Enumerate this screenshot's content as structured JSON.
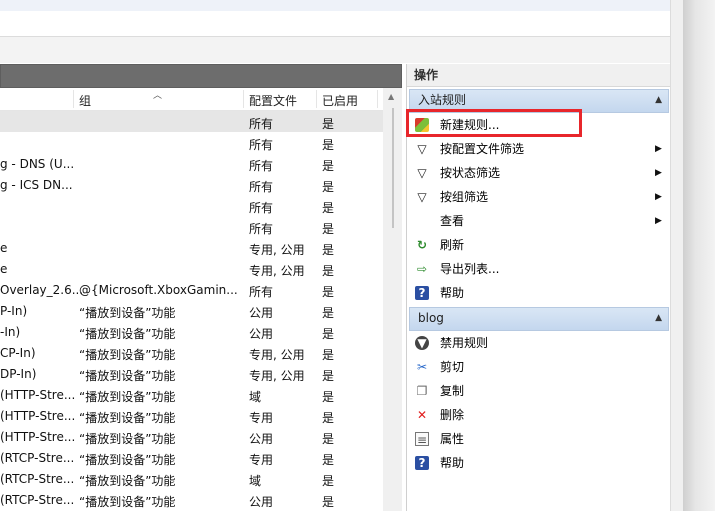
{
  "columns": {
    "group": "组",
    "profile": "配置文件",
    "enabled": "已启用"
  },
  "rows": [
    {
      "name": "",
      "group": "",
      "profile": "所有",
      "enabled": "是"
    },
    {
      "name": "",
      "group": "",
      "profile": "所有",
      "enabled": "是"
    },
    {
      "name": "g - DNS (U...",
      "group": "",
      "profile": "所有",
      "enabled": "是"
    },
    {
      "name": "g - ICS DN...",
      "group": "",
      "profile": "所有",
      "enabled": "是"
    },
    {
      "name": "",
      "group": "",
      "profile": "所有",
      "enabled": "是"
    },
    {
      "name": "",
      "group": "",
      "profile": "所有",
      "enabled": "是"
    },
    {
      "name": "e",
      "group": "",
      "profile": "专用, 公用",
      "enabled": "是"
    },
    {
      "name": "e",
      "group": "",
      "profile": "专用, 公用",
      "enabled": "是"
    },
    {
      "name": "Overlay_2.6...",
      "group": "@{Microsoft.XboxGamin...",
      "profile": "所有",
      "enabled": "是"
    },
    {
      "name": "P-In)",
      "group": "“播放到设备”功能",
      "profile": "公用",
      "enabled": "是"
    },
    {
      "name": "-In)",
      "group": "“播放到设备”功能",
      "profile": "公用",
      "enabled": "是"
    },
    {
      "name": "CP-In)",
      "group": "“播放到设备”功能",
      "profile": "专用, 公用",
      "enabled": "是"
    },
    {
      "name": "DP-In)",
      "group": "“播放到设备”功能",
      "profile": "专用, 公用",
      "enabled": "是"
    },
    {
      "name": "(HTTP-Stre...",
      "group": "“播放到设备”功能",
      "profile": "域",
      "enabled": "是"
    },
    {
      "name": "(HTTP-Stre...",
      "group": "“播放到设备”功能",
      "profile": "专用",
      "enabled": "是"
    },
    {
      "name": "(HTTP-Stre...",
      "group": "“播放到设备”功能",
      "profile": "公用",
      "enabled": "是"
    },
    {
      "name": "(RTCP-Stre...",
      "group": "“播放到设备”功能",
      "profile": "专用",
      "enabled": "是"
    },
    {
      "name": "(RTCP-Stre...",
      "group": "“播放到设备”功能",
      "profile": "域",
      "enabled": "是"
    },
    {
      "name": "(RTCP-Stre...",
      "group": "“播放到设备”功能",
      "profile": "公用",
      "enabled": "是"
    }
  ],
  "actions": {
    "title": "操作",
    "section1": {
      "label": "入站规则",
      "items": [
        {
          "label": "新建规则...",
          "icon": "new-rule-icon"
        },
        {
          "label": "按配置文件筛选",
          "icon": "filter-icon"
        },
        {
          "label": "按状态筛选",
          "icon": "filter-icon"
        },
        {
          "label": "按组筛选",
          "icon": "filter-icon"
        },
        {
          "label": "查看",
          "icon": ""
        },
        {
          "label": "刷新",
          "icon": "refresh-icon"
        },
        {
          "label": "导出列表...",
          "icon": "export-icon"
        },
        {
          "label": "帮助",
          "icon": "help-icon"
        }
      ]
    },
    "section2": {
      "label": "blog",
      "items": [
        {
          "label": "禁用规则",
          "icon": "disable-icon"
        },
        {
          "label": "剪切",
          "icon": "cut-icon"
        },
        {
          "label": "复制",
          "icon": "copy-icon"
        },
        {
          "label": "删除",
          "icon": "delete-icon"
        },
        {
          "label": "属性",
          "icon": "properties-icon"
        },
        {
          "label": "帮助",
          "icon": "help-icon"
        }
      ]
    }
  },
  "colors": {
    "highlight": "#e8262b",
    "section_header": "#c4d7ee",
    "pane_title": "#6d6d6d"
  }
}
